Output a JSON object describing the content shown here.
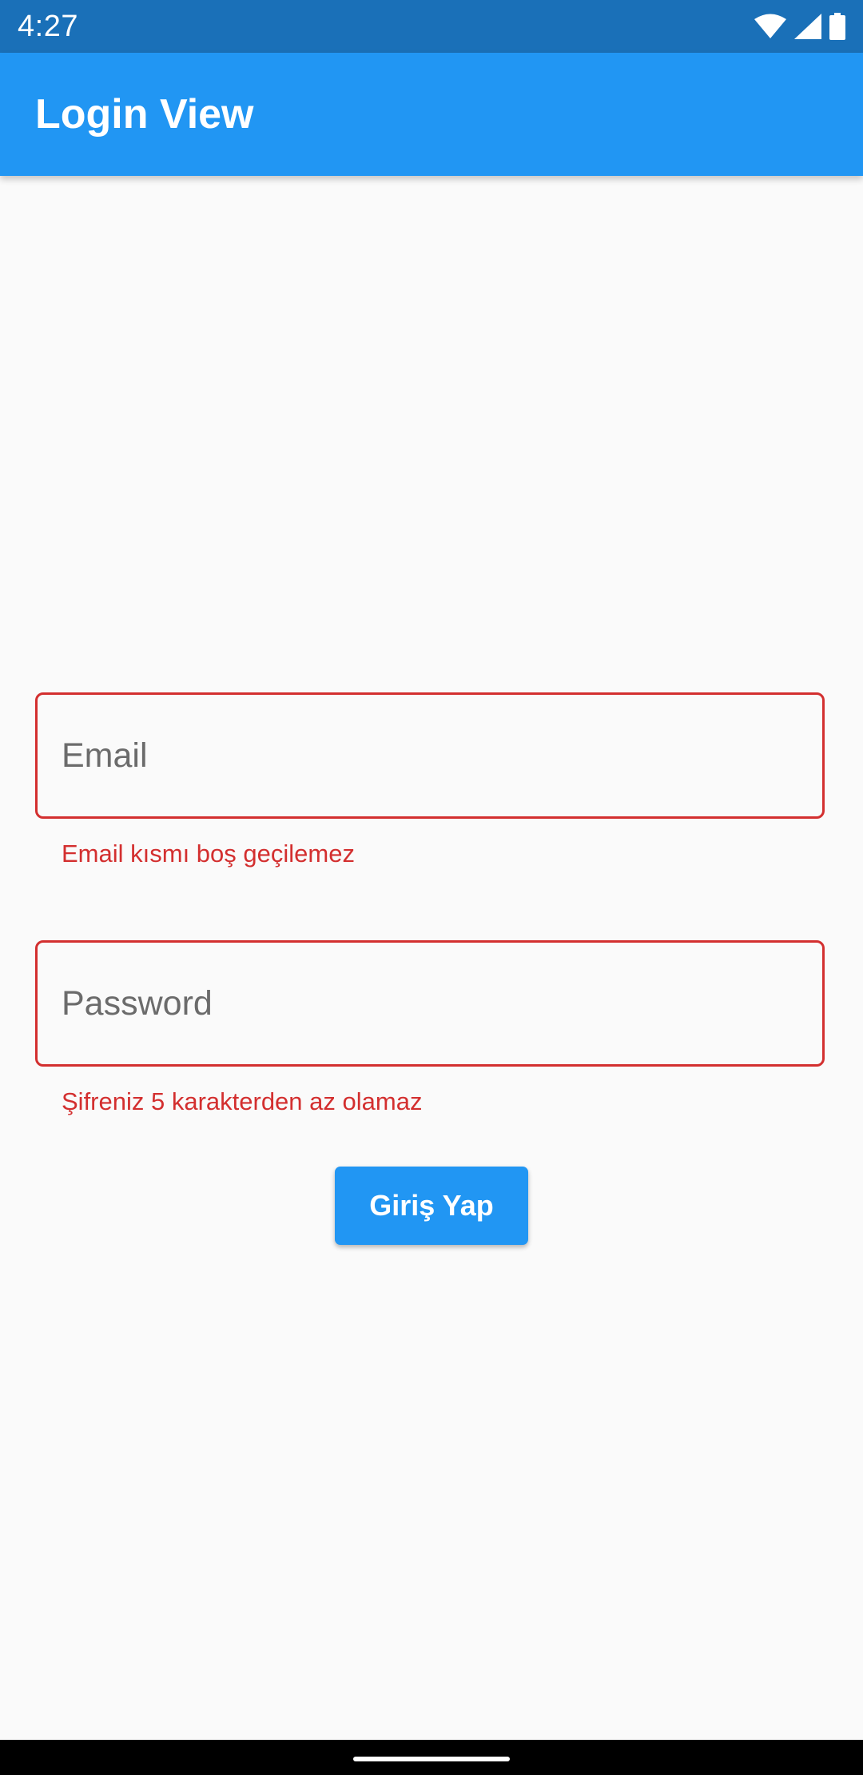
{
  "status_bar": {
    "time": "4:27",
    "icons": [
      "wifi-icon",
      "cell-signal-icon",
      "battery-icon"
    ],
    "background_color": "#1a70b8"
  },
  "app_bar": {
    "title": "Login View",
    "background_color": "#2196f3"
  },
  "form": {
    "email": {
      "placeholder": "Email",
      "value": "",
      "error": "Email kısmı boş geçilemez"
    },
    "password": {
      "placeholder": "Password",
      "value": "",
      "error": "Şifreniz 5 karakterden az olamaz"
    },
    "submit_label": "Giriş Yap",
    "error_color": "#d32f2f",
    "accent_color": "#2196f3"
  },
  "nav_bar": {
    "icons": [
      "home-handle"
    ]
  }
}
